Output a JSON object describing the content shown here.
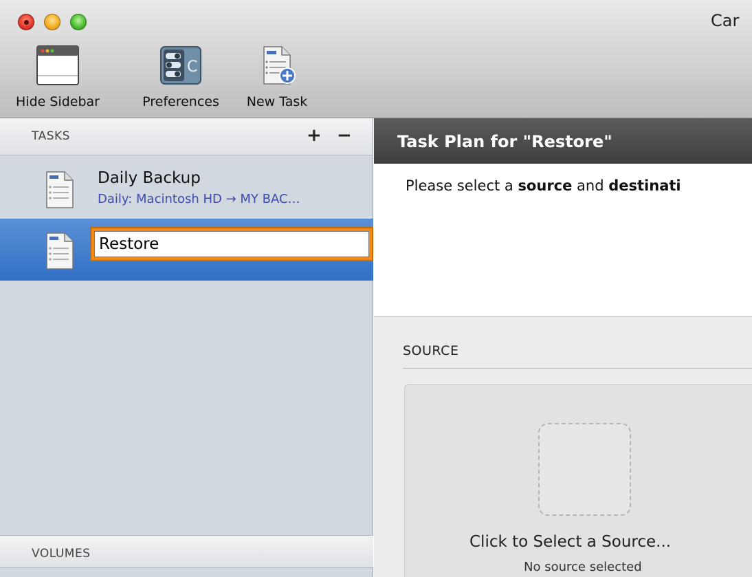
{
  "window": {
    "title": "Carbon Copy Cloner",
    "title_visible": "Car"
  },
  "toolbar": {
    "items": [
      {
        "label": "Hide Sidebar",
        "icon": "window-sidebar-icon"
      },
      {
        "label": "Preferences",
        "icon": "preferences-toggles-icon"
      },
      {
        "label": "New Task",
        "icon": "new-task-document-icon"
      }
    ]
  },
  "sidebar": {
    "tasks_header": "TASKS",
    "add_label": "+",
    "remove_label": "−",
    "tasks": [
      {
        "name": "Daily Backup",
        "subtitle": "Daily: Macintosh HD → MY BAC…",
        "icon": "task-document-icon"
      },
      {
        "name": "Restore",
        "subtitle": "",
        "icon": "task-document-icon",
        "selected": true,
        "editing": true
      }
    ],
    "volumes_header": "VOLUMES"
  },
  "main": {
    "plan_header": "Task Plan for \"Restore\"",
    "instruction_prefix": "Please select a ",
    "instruction_source": "source",
    "instruction_mid": " and ",
    "instruction_dest": "destinati",
    "source_section": "SOURCE",
    "source_cta": "Click to Select a Source...",
    "source_status": "No source selected"
  },
  "colors": {
    "selection_blue": "#3c78c8",
    "focus_orange": "#f08a1c",
    "subtitle_blue": "#3c4aa8",
    "header_dark": "#4a4a4a"
  }
}
